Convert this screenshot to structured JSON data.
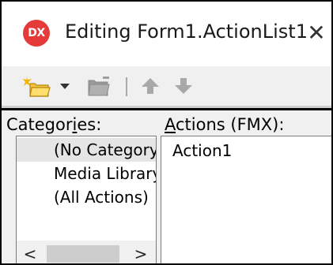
{
  "window": {
    "app_icon_text": "DX",
    "title": "Editing Form1.ActionList1",
    "close_glyph": "✕"
  },
  "toolbar": {
    "buttons": [
      {
        "name": "new-action",
        "icon": "new-action-icon"
      },
      {
        "name": "new-action-dropdown",
        "icon": "chevron-down-icon"
      },
      {
        "name": "delete-action",
        "icon": "delete-action-icon"
      },
      {
        "name": "move-up",
        "icon": "arrow-up-icon"
      },
      {
        "name": "move-down",
        "icon": "arrow-down-icon"
      }
    ]
  },
  "categories": {
    "label_pre": "Categor",
    "label_access": "i",
    "label_post": "es:",
    "items": [
      {
        "label": "(No Category)",
        "selected": true
      },
      {
        "label": "Media Library",
        "selected": false
      },
      {
        "label": "(All Actions)",
        "selected": false
      }
    ],
    "scroll_left": "<",
    "scroll_right": ">"
  },
  "actions": {
    "label_access": "A",
    "label_rest": "ctions (FMX):",
    "items": [
      "Action1"
    ]
  },
  "colors": {
    "app_icon_bg": "#e53a3a",
    "selected_item_bg": "#e5e5e5",
    "panel_bg": "#f0f0f0"
  }
}
